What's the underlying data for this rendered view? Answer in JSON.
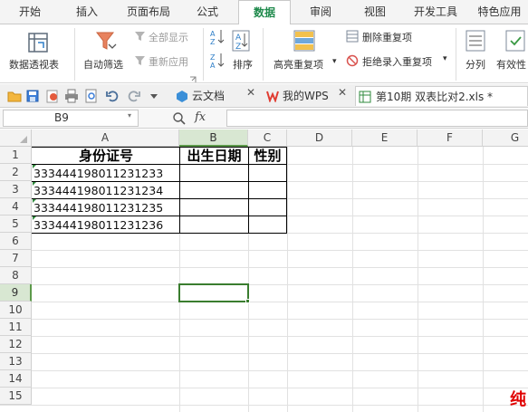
{
  "menu": {
    "tabs": [
      "开始",
      "插入",
      "页面布局",
      "公式",
      "数据",
      "审阅",
      "视图",
      "开发工具",
      "特色应用"
    ],
    "active": "数据"
  },
  "ribbon": {
    "pivot_label": "数据透视表",
    "autofilter_label": "自动筛选",
    "show_all_label": "全部显示",
    "reapply_label": "重新应用",
    "sort_label": "排序",
    "highlight_dup_label": "高亮重复项",
    "remove_dup_label": "删除重复项",
    "reject_dup_label": "拒绝录入重复项",
    "split_label": "分列",
    "validity_label": "有效性"
  },
  "doc_tabs": {
    "cloud_label": "云文档",
    "wps_label": "我的WPS",
    "file_label": "第10期 双表比对2.xls *"
  },
  "formula_bar": {
    "name_box": "B9",
    "fx_label": "fx",
    "formula": ""
  },
  "sheet": {
    "columns": [
      "A",
      "B",
      "C",
      "D",
      "E",
      "F",
      "G"
    ],
    "rows": [
      "1",
      "2",
      "3",
      "4",
      "5",
      "6",
      "7",
      "8",
      "9",
      "10",
      "11",
      "12",
      "13",
      "14",
      "15"
    ],
    "selected_cell": "B9",
    "header_row": [
      "身份证号",
      "出生日期",
      "性别"
    ],
    "ids": [
      "333444198011231233",
      "333444198011231234",
      "333444198011231235",
      "333444198011231236"
    ]
  },
  "watermark": "纯",
  "colors": {
    "accent": "#1f8a4c",
    "selection": "#3a7d2f",
    "header_selected_bg": "#d8e7d2"
  }
}
